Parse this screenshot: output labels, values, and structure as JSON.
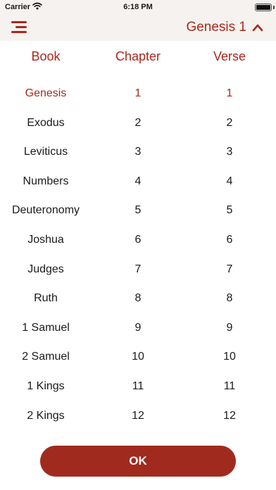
{
  "status_bar": {
    "carrier": "Carrier",
    "time": "6:18 PM",
    "icons": [
      "wifi-icon",
      "battery-icon"
    ]
  },
  "nav": {
    "title": "Genesis 1",
    "menu_icon": "hamburger-menu-icon",
    "toggle_icon": "chevron-up-icon"
  },
  "columns": {
    "book": "Book",
    "chapter": "Chapter",
    "verse": "Verse"
  },
  "books": [
    "Genesis",
    "Exodus",
    "Leviticus",
    "Numbers",
    "Deuteronomy",
    "Joshua",
    "Judges",
    "Ruth",
    "1 Samuel",
    "2 Samuel",
    "1 Kings",
    "2 Kings"
  ],
  "chapters": [
    "1",
    "2",
    "3",
    "4",
    "5",
    "6",
    "7",
    "8",
    "9",
    "10",
    "11",
    "12"
  ],
  "verses": [
    "1",
    "2",
    "3",
    "4",
    "5",
    "6",
    "7",
    "8",
    "9",
    "10",
    "11",
    "12"
  ],
  "selected": {
    "book": "Genesis",
    "chapter": "1",
    "verse": "1"
  },
  "ok_label": "OK",
  "colors": {
    "accent": "#a8281c",
    "button": "#a12a1e",
    "header_bg": "#f6f2ef"
  }
}
